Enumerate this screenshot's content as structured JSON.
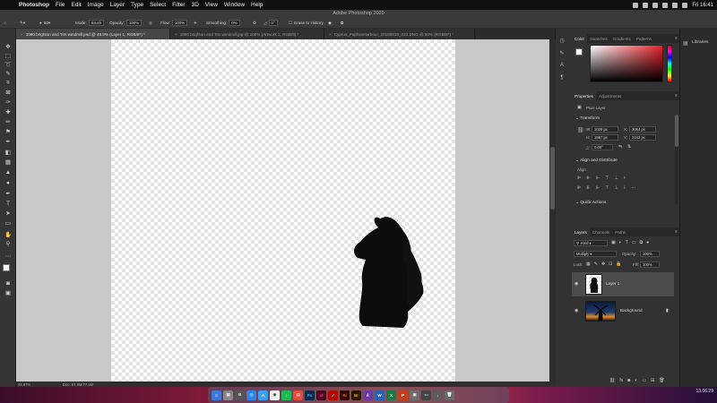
{
  "menubar": {
    "app_name": "Photoshop",
    "items": [
      "File",
      "Edit",
      "Image",
      "Layer",
      "Type",
      "Select",
      "Filter",
      "3D",
      "View",
      "Window",
      "Help"
    ],
    "clock": "Fri 16:41"
  },
  "window_title": "Adobe Photoshop 2020",
  "options_bar": {
    "brush_size": "60",
    "mode_label": "Mode:",
    "mode_value": "Brush",
    "opacity_label": "Opacity:",
    "opacity_value": "100%",
    "flow_label": "Flow:",
    "flow_value": "100%",
    "smoothing_label": "Smoothing:",
    "smoothing_value": "0%",
    "angle_value": "0°",
    "erase_to_history": "Erase to History"
  },
  "tabs": [
    {
      "label": "1080 brighton and Tim windmill.psd @ 49.9% (Layer 1, RGB/8*) *",
      "active": true
    },
    {
      "label": "1080 brighton and Tim windmill.jpg @ 200% (Artwork 1, RGB/8) *",
      "active": false
    },
    {
      "label": "Cyprus_PaphosHarbour_20180918_023.DNG @ 50% (RGB/8*) *",
      "active": false
    }
  ],
  "status_bar": {
    "zoom": "49.87%",
    "doc_size": "Doc: 87.9M/77.5M"
  },
  "color_panel": {
    "tabs": [
      "Color",
      "Swatches",
      "Gradients",
      "Patterns"
    ],
    "hue_color": "#e8202a"
  },
  "properties_panel": {
    "tabs": [
      "Properties",
      "Adjustments"
    ],
    "layer_type": "Pixel Layer",
    "transform_title": "Transform",
    "w_label": "W:",
    "w_value": "1028 px",
    "h_label": "H:",
    "h_value": "1987 px",
    "x_label": "X:",
    "x_value": "3054 px",
    "y_label": "Y:",
    "y_value": "2243 px",
    "angle_label": "△",
    "angle_value": "0.00°",
    "align_title": "Align and Distribute",
    "align_label": "Align:",
    "quick_actions_title": "Quick Actions"
  },
  "layers_panel": {
    "tabs": [
      "Layers",
      "Channels",
      "Paths"
    ],
    "filter_label": "Kind",
    "blend_mode": "Multiply",
    "opacity_label": "Opacity:",
    "opacity_value": "100%",
    "lock_label": "Lock:",
    "fill_label": "Fill:",
    "fill_value": "100%",
    "layers": [
      {
        "name": "Layer 1",
        "selected": true
      },
      {
        "name": "Background",
        "selected": false
      }
    ]
  },
  "libraries_label": "Libraries",
  "dock": {
    "apps": [
      {
        "label": "Ps",
        "color": "#0b2b4a"
      },
      {
        "label": "Id",
        "color": "#49021f"
      },
      {
        "label": "",
        "color": "#b30b00"
      },
      {
        "label": "Ai",
        "color": "#330000"
      },
      {
        "label": "Br",
        "color": "#2b1700"
      }
    ],
    "date": "13.06.29"
  }
}
